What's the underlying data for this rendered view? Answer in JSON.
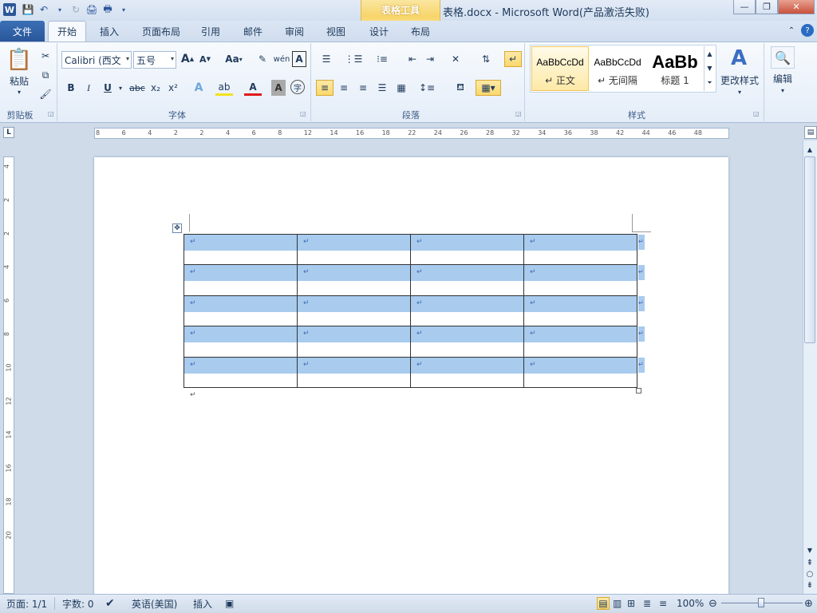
{
  "window": {
    "title": "表格.docx  -  Microsoft Word(产品激活失败)"
  },
  "contextual": {
    "label": "表格工具"
  },
  "tabs": [
    "文件",
    "开始",
    "插入",
    "页面布局",
    "引用",
    "邮件",
    "审阅",
    "视图",
    "设计",
    "布局"
  ],
  "clipboard": {
    "paste": "粘贴",
    "label": "剪贴板"
  },
  "font": {
    "name": "Calibri (西文正",
    "size": "五号",
    "label": "字体",
    "grow": "A",
    "shrink": "A",
    "case": "Aa",
    "bold": "B",
    "italic": "I",
    "underline": "U",
    "strike": "abc",
    "sub": "x₂",
    "sup": "x²"
  },
  "paragraph": {
    "label": "段落"
  },
  "styles": {
    "label": "样式",
    "items": [
      {
        "preview": "AaBbCcDd",
        "name": "↵ 正文"
      },
      {
        "preview": "AaBbCcDd",
        "name": "↵ 无间隔"
      },
      {
        "preview": "AaBb",
        "name": "标题 1"
      }
    ],
    "change": "更改样式"
  },
  "editing": {
    "label": "编辑"
  },
  "ruler": {
    "h_ticks": [
      "8",
      "6",
      "4",
      "2",
      "2",
      "4",
      "6",
      "8",
      "12",
      "14",
      "16",
      "18",
      "22",
      "24",
      "26",
      "28",
      "32",
      "34",
      "36",
      "38",
      "42",
      "44",
      "46",
      "48"
    ],
    "v_ticks": [
      "4",
      "2",
      "2",
      "4",
      "6",
      "8",
      "10",
      "12",
      "14",
      "16",
      "18",
      "20"
    ]
  },
  "table": {
    "rows": 5,
    "cols": 4,
    "cell_mark": "↵"
  },
  "after_table_mark": "↵",
  "status": {
    "page": "页面: 1/1",
    "words": "字数: 0",
    "language": "英语(美国)",
    "insert": "插入",
    "zoom": "100%"
  }
}
